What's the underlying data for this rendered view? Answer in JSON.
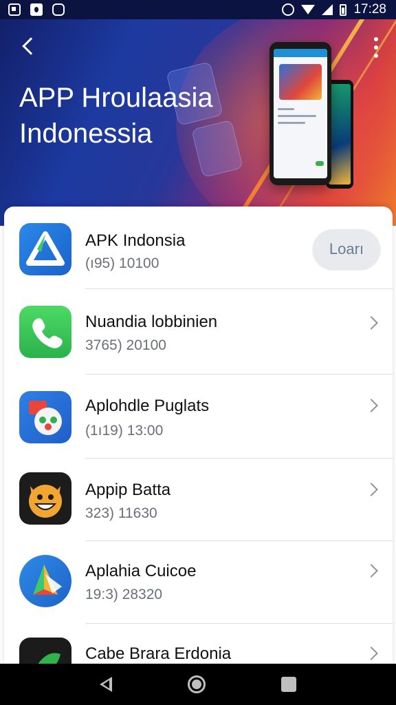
{
  "status_bar": {
    "time": "17:28"
  },
  "header": {
    "title": "APP Hroulaasia Indonessia"
  },
  "apps": [
    {
      "name": "APK Indonsia",
      "meta": "(ı95)  10100",
      "action": "Loarı",
      "icon": "app-triangle-icon"
    },
    {
      "name": "Nuandia lobbinien",
      "meta": "3765)  20100",
      "icon": "phone-call-icon"
    },
    {
      "name": "Aplohdle Puglats",
      "meta": "(1ı19)  13:00",
      "icon": "cartoon-face-icon"
    },
    {
      "name": "Appip Batta",
      "meta": "323)  11630",
      "icon": "monster-face-icon"
    },
    {
      "name": "Aplahia Cuicoe",
      "meta": "19:3)  28320",
      "icon": "colorful-triangle-icon"
    },
    {
      "name": "Cabe Brara Erdonia",
      "meta": "",
      "icon": "green-leaf-icon"
    }
  ],
  "colors": {
    "accent_blue": "#2b88e8",
    "button_bg": "#e8eaed",
    "button_text": "#6a7d96"
  }
}
